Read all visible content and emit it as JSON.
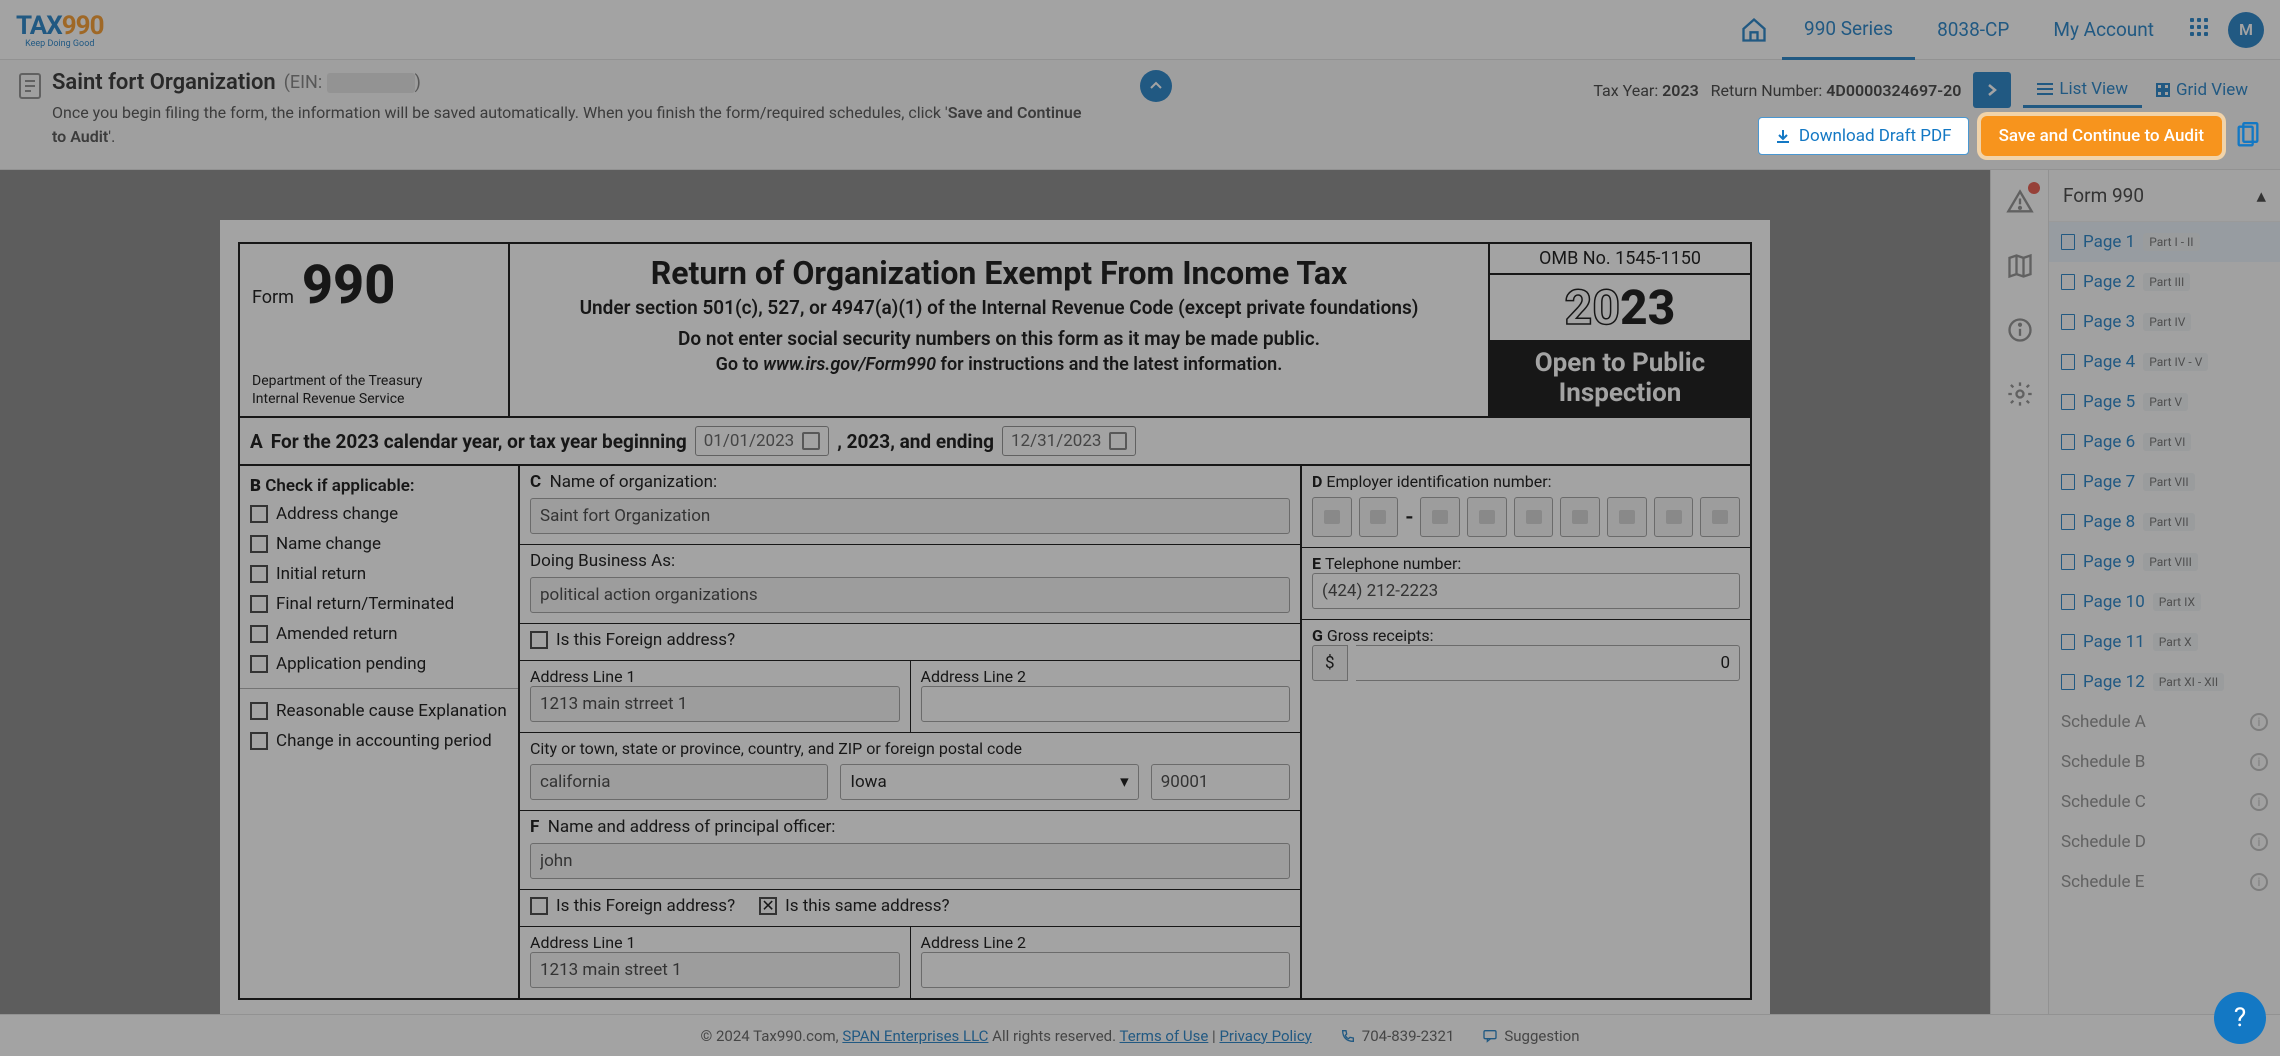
{
  "brand": {
    "name_a": "TAX",
    "name_b": "990",
    "tagline": "Keep Doing Good"
  },
  "nav": {
    "series": "990 Series",
    "cp": "8038-CP",
    "account": "My Account",
    "avatar": "M"
  },
  "sub": {
    "org": "Saint fort Organization",
    "ein_label": "(EIN:",
    "ein_close": ")",
    "instr_a": "Once you begin filing the form, the information will be saved automatically. When you finish the form/required schedules, click '",
    "instr_b": "Save and Continue to Audit",
    "instr_c": "'.",
    "tax_year_lbl": "Tax Year:",
    "tax_year": "2023",
    "return_lbl": "Return Number:",
    "return_no": "4D0000324697-20",
    "download": "Download Draft PDF",
    "save_cont": "Save and Continue to Audit",
    "list_view": "List View",
    "grid_view": "Grid View"
  },
  "form": {
    "form_word": "Form",
    "form_no": "990",
    "dept1": "Department of the Treasury",
    "dept2": "Internal Revenue Service",
    "title": "Return of Organization Exempt From Income Tax",
    "sub1": "Under section 501(c), 527, or 4947(a)(1) of the Internal Revenue Code (except private foundations)",
    "sub2": "Do not enter social security numbers on this form as it may be made public.",
    "sub3a": "Go to ",
    "sub3b": "www.irs.gov/Form990",
    "sub3c": " for instructions and the latest information.",
    "omb": "OMB No. 1545-1150",
    "year_outline": "20",
    "year_bold": "23",
    "open_pub": "Open to Public Inspection",
    "rowA_a": "A",
    "rowA_b": " For the 2023 calendar year, or tax year beginning",
    "rowA_mid": ", 2023, and ending",
    "date_begin": "01/01/2023",
    "date_end": "12/31/2023",
    "B_hdr": "B",
    "B_chk": "Check if applicable:",
    "b1": "Address change",
    "b2": "Name change",
    "b3": "Initial return",
    "b4": "Final return/Terminated",
    "b5": "Amended return",
    "b6": "Application pending",
    "b7": "Reasonable cause Explanation",
    "b8": "Change in accounting period",
    "C_lbl": "C",
    "C_text": "Name of organization:",
    "C_val": "Saint fort Organization",
    "dba_lbl": "Doing Business As:",
    "dba_val": "political action organizations",
    "foreign_q": "Is this Foreign address?",
    "addr1_lbl": "Address Line 1",
    "addr1_val": "1213 main strreet 1",
    "addr2_lbl": "Address Line 2",
    "city_lbl": "City or town, state or province, country, and ZIP or foreign postal code",
    "city_val": "california",
    "state_val": "Iowa",
    "zip_val": "90001",
    "F_lbl": "F",
    "F_text": "Name and address of principal officer:",
    "F_val": "john",
    "same_q": "Is this same address?",
    "F_addr1": "1213 main street 1",
    "D_lbl": "D",
    "D_text": "Employer identification number:",
    "E_lbl": "E",
    "E_text": "Telephone number:",
    "E_val": "(424) 212-2223",
    "G_lbl": "G",
    "G_text": "Gross receipts:",
    "G_dollar": "$",
    "G_val": "0"
  },
  "pagenav": {
    "title": "Form 990",
    "pages": [
      {
        "label": "Page 1",
        "part": "Part I - II"
      },
      {
        "label": "Page 2",
        "part": "Part III"
      },
      {
        "label": "Page 3",
        "part": "Part IV"
      },
      {
        "label": "Page 4",
        "part": "Part IV - V"
      },
      {
        "label": "Page 5",
        "part": "Part V"
      },
      {
        "label": "Page 6",
        "part": "Part VI"
      },
      {
        "label": "Page 7",
        "part": "Part VII"
      },
      {
        "label": "Page 8",
        "part": "Part VII"
      },
      {
        "label": "Page 9",
        "part": "Part VIII"
      },
      {
        "label": "Page 10",
        "part": "Part IX"
      },
      {
        "label": "Page 11",
        "part": "Part X"
      },
      {
        "label": "Page 12",
        "part": "Part XI - XII"
      }
    ],
    "schedules": [
      "Schedule A",
      "Schedule B",
      "Schedule C",
      "Schedule D",
      "Schedule E"
    ]
  },
  "footer": {
    "copy_a": "© 2024 Tax990.com, ",
    "span_link": "SPAN Enterprises LLC",
    "copy_b": " All rights reserved. ",
    "terms": "Terms of Use",
    "sep": " | ",
    "priv": "Privacy Policy",
    "phone": "704-839-2321",
    "sugg": "Suggestion"
  },
  "help": "?"
}
